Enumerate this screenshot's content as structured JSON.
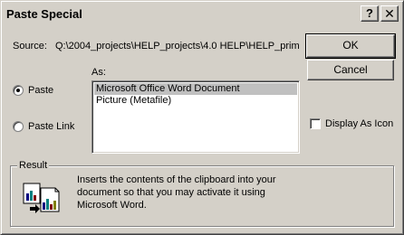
{
  "window": {
    "title": "Paste Special",
    "help_glyph": "?",
    "close_glyph": "✕"
  },
  "source": {
    "label": "Source:",
    "value": "Q:\\2004_projects\\HELP_projects\\4.0 HELP\\HELP_prim"
  },
  "as_label": "As:",
  "options": {
    "paste": {
      "label": "Paste",
      "selected": true
    },
    "paste_link": {
      "label": "Paste Link",
      "selected": false
    }
  },
  "list": {
    "items": [
      {
        "label": "Microsoft Office Word Document",
        "selected": true
      },
      {
        "label": "Picture (Metafile)",
        "selected": false
      }
    ]
  },
  "buttons": {
    "ok": "OK",
    "cancel": "Cancel"
  },
  "display_as_icon": {
    "label": "Display As Icon",
    "checked": false
  },
  "result": {
    "label": "Result",
    "line1": "Inserts the contents of the clipboard into your",
    "line2": "document so that you may activate it using",
    "line3": "Microsoft Word.",
    "icon": "paste-document-icon"
  },
  "colors": {
    "face": "#d4d0c8",
    "selection": "#c0c0c0"
  }
}
